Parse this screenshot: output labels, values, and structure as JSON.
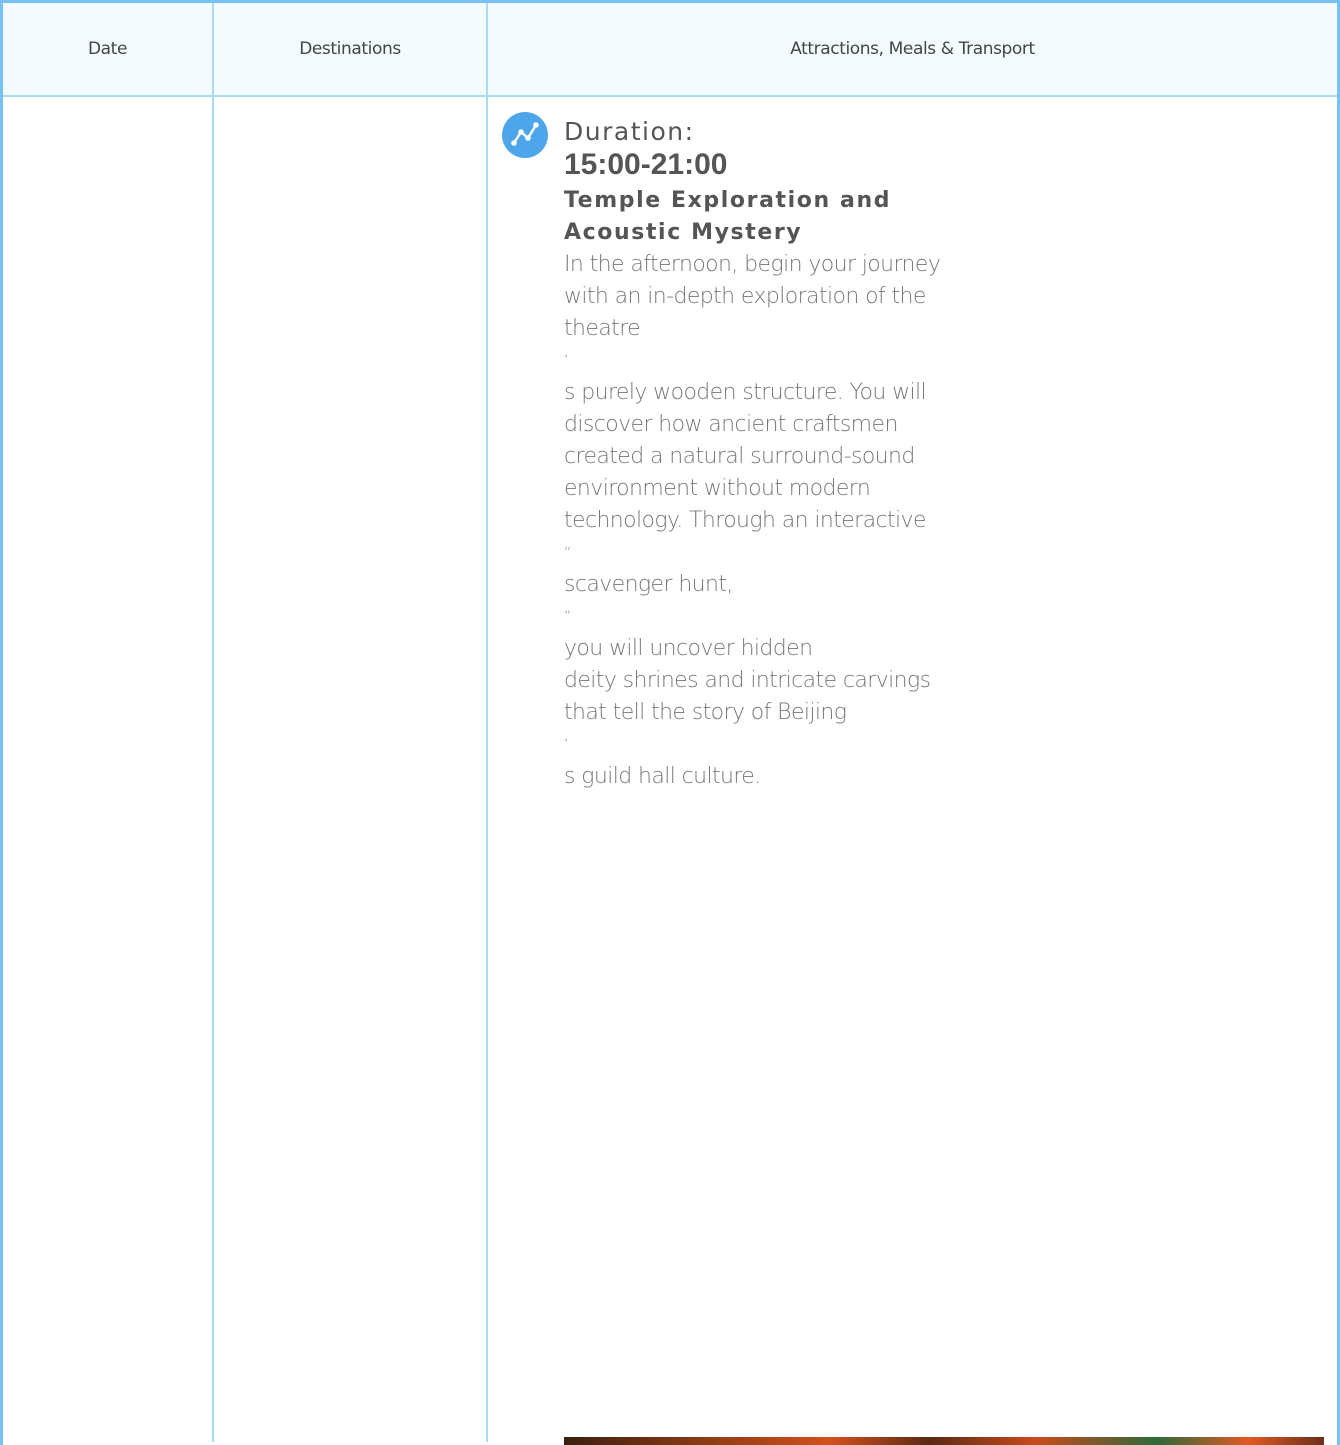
{
  "table": {
    "headers": {
      "date": "Date",
      "destinations": "Destinations",
      "details": "Attractions, Meals & Transport"
    }
  },
  "activity": {
    "icon": "route-icon",
    "duration_label": "Duration:",
    "duration_time": "15:00-21:00",
    "title": "Temple Exploration and Acoustic Mystery",
    "description_lines": [
      "In the afternoon, begin your journey",
      "with an in-depth exploration of the",
      "theatre",
      "’",
      "s purely wooden structure. You will",
      "discover how ancient craftsmen",
      "created a natural surround-sound",
      "environment without modern",
      "technology. Through an interactive",
      "“",
      "scavenger hunt,",
      "”",
      "you will uncover hidden",
      "deity shrines and intricate carvings",
      "that tell the story of Beijing",
      "’",
      "s guild hall culture."
    ]
  },
  "colors": {
    "border": "#79c1f1",
    "grid": "#a7dcf3",
    "header_bg": "#f3fbfe",
    "icon_bg": "#4da6ea"
  }
}
